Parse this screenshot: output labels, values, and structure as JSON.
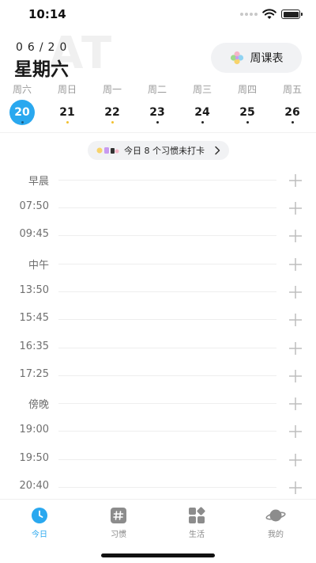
{
  "status_bar": {
    "time": "10:14"
  },
  "header": {
    "watermark": "AT",
    "date": "06/20",
    "weekday": "星期六",
    "timetable_label": "周课表"
  },
  "week": {
    "days": [
      {
        "weekday": "周六",
        "date": "20",
        "active": true
      },
      {
        "weekday": "周日",
        "date": "21"
      },
      {
        "weekday": "周一",
        "date": "22"
      },
      {
        "weekday": "周二",
        "date": "23"
      },
      {
        "weekday": "周三",
        "date": "24"
      },
      {
        "weekday": "周四",
        "date": "25"
      },
      {
        "weekday": "周五",
        "date": "26"
      }
    ]
  },
  "habit_banner": {
    "text": "今日 8 个习惯未打卡"
  },
  "timeline": {
    "slots": [
      "早晨",
      "07:50",
      "09:45",
      "中午",
      "13:50",
      "15:45",
      "16:35",
      "17:25",
      "傍晚",
      "19:00",
      "19:50",
      "20:40"
    ]
  },
  "tabbar": {
    "tabs": [
      {
        "label": "今日",
        "icon": "clock-icon",
        "active": true
      },
      {
        "label": "习惯",
        "icon": "hashtag-icon"
      },
      {
        "label": "生活",
        "icon": "grid-icon"
      },
      {
        "label": "我的",
        "icon": "planet-icon"
      }
    ]
  },
  "colors": {
    "accent": "#2aa8ef",
    "pill_bg": "#f1f2f4",
    "muted": "#9a9a9a"
  }
}
